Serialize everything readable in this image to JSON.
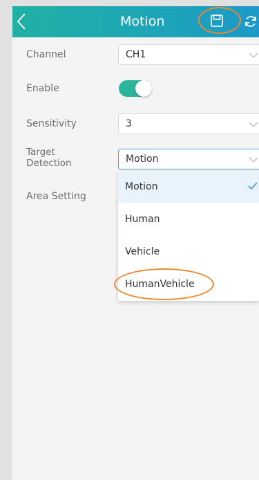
{
  "header": {
    "title": "Motion",
    "back_icon": "chevron-left-icon",
    "save_icon": "save-icon",
    "refresh_icon": "refresh-icon"
  },
  "form": {
    "channel": {
      "label": "Channel",
      "value": "CH1"
    },
    "enable": {
      "label": "Enable",
      "on": true
    },
    "sensitivity": {
      "label": "Sensitivity",
      "value": "3"
    },
    "target_detection": {
      "label_line1": "Target",
      "label_line2": "Detection",
      "value": "Motion",
      "options": [
        "Motion",
        "Human",
        "Vehicle",
        "HumanVehicle"
      ],
      "selected_option": "Motion"
    },
    "area_setting": {
      "label": "Area Setting"
    }
  },
  "colors": {
    "header_gradient_start": "#1fb0a4",
    "header_gradient_end": "#1c99c9",
    "toggle_on": "#2bb39b",
    "selected_option_bg": "#e8f3fc",
    "checkmark": "#3d8fd6",
    "annotation": "#f0862c"
  }
}
